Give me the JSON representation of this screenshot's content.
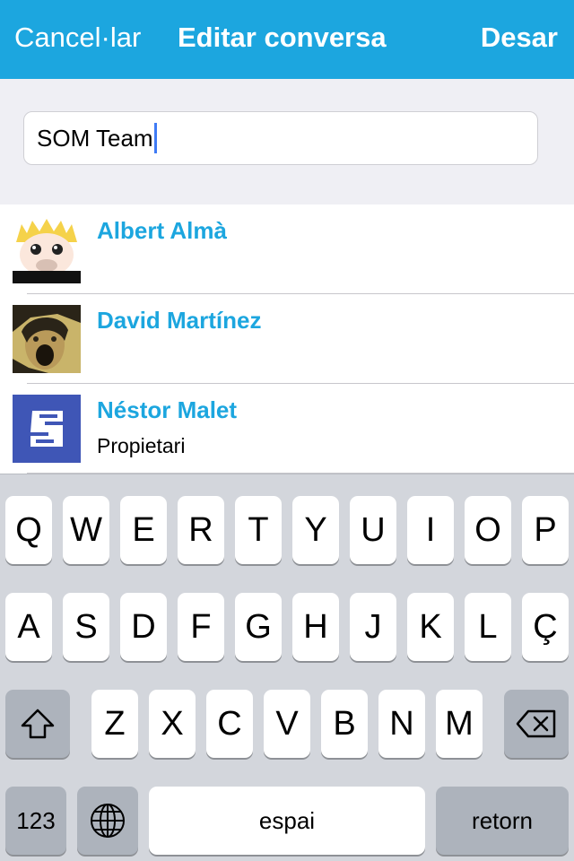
{
  "navbar": {
    "cancel_label": "Cancel·lar",
    "title": "Editar conversa",
    "save_label": "Desar"
  },
  "name_field": {
    "value": "SOM Team"
  },
  "members": [
    {
      "name": "Albert Almà",
      "role": ""
    },
    {
      "name": "David Martínez",
      "role": ""
    },
    {
      "name": "Néstor Malet",
      "role": "Propietari"
    }
  ],
  "keyboard": {
    "row1": [
      "Q",
      "W",
      "E",
      "R",
      "T",
      "Y",
      "U",
      "I",
      "O",
      "P"
    ],
    "row2": [
      "A",
      "S",
      "D",
      "F",
      "G",
      "H",
      "J",
      "K",
      "L",
      "Ç"
    ],
    "row3": [
      "Z",
      "X",
      "C",
      "V",
      "B",
      "N",
      "M"
    ],
    "numbers_label": "123",
    "space_label": "espai",
    "return_label": "retorn"
  },
  "colors": {
    "accent": "#1ca6df",
    "caret": "#3f7bf5"
  }
}
